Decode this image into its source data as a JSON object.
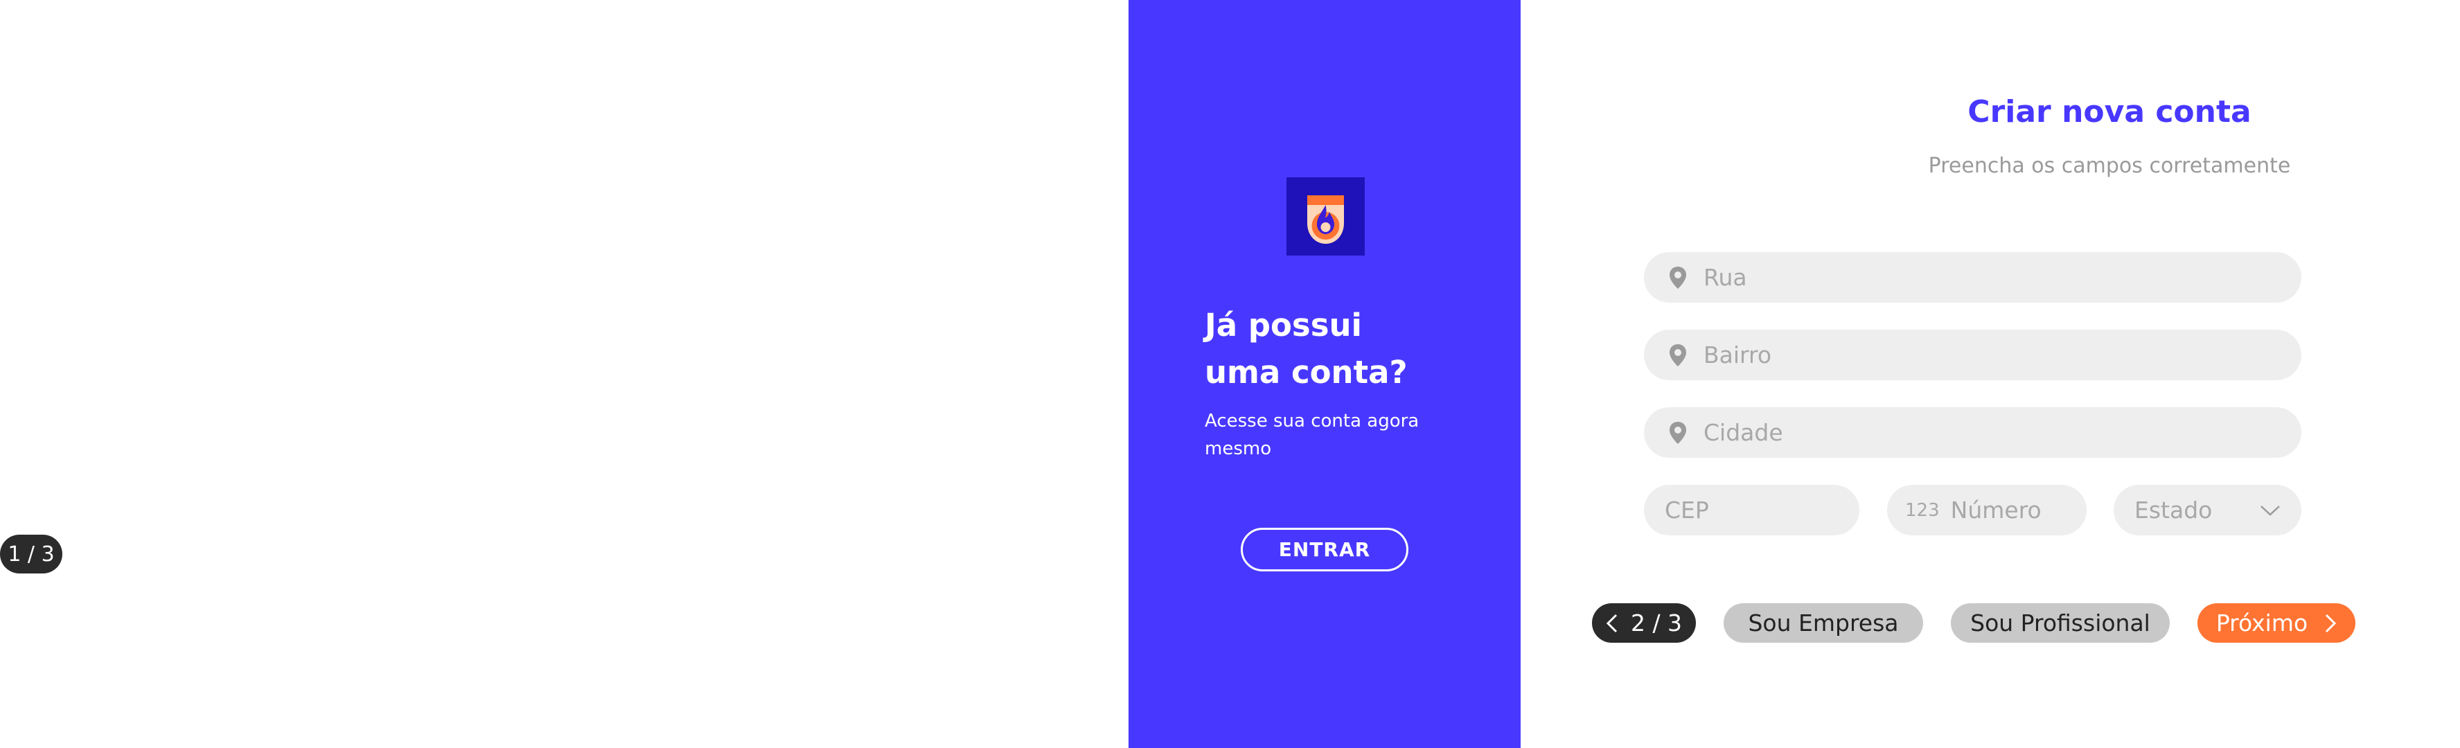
{
  "left_pager": {
    "text": "1 / 3"
  },
  "signin_panel": {
    "heading_line1": "Já possui",
    "heading_line2": "uma conta?",
    "subtitle": "Acesse sua conta agora mesmo",
    "enter_button": "ENTRAR",
    "bg_color": "#4838ff"
  },
  "form": {
    "title": "Criar nova conta",
    "subtitle": "Preencha os campos corretamente",
    "fields": {
      "street": {
        "placeholder": "Rua",
        "icon": "location-pin-icon"
      },
      "district": {
        "placeholder": "Bairro",
        "icon": "location-pin-icon"
      },
      "city": {
        "placeholder": "Cidade",
        "icon": "location-pin-icon"
      },
      "cep": {
        "placeholder": "CEP"
      },
      "number": {
        "placeholder": "Número",
        "icon_text": "123"
      },
      "state": {
        "placeholder": "Estado",
        "icon": "chevron-down-icon"
      }
    }
  },
  "footer": {
    "pager": "2 / 3",
    "company_button": "Sou Empresa",
    "professional_button": "Sou Profissional",
    "next_button": "Próximo"
  },
  "colors": {
    "accent": "#4838ff",
    "orange": "#ff7432",
    "dark": "#2b2b2b"
  }
}
